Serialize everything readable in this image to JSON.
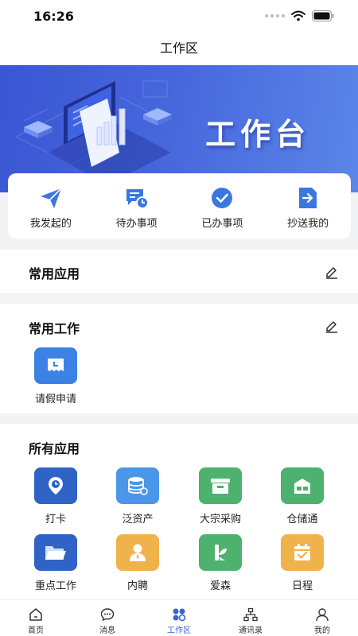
{
  "status_bar": {
    "time": "16:26"
  },
  "header": {
    "title": "工作区"
  },
  "banner": {
    "title": "工作台"
  },
  "quick_actions": [
    {
      "label": "我发起的",
      "icon": "paper-plane-icon"
    },
    {
      "label": "待办事项",
      "icon": "pending-clock-icon"
    },
    {
      "label": "已办事项",
      "icon": "check-circle-icon"
    },
    {
      "label": "抄送我的",
      "icon": "forward-doc-icon"
    }
  ],
  "common_apps": {
    "title": "常用应用"
  },
  "common_work": {
    "title": "常用工作",
    "items": [
      {
        "label": "请假申请",
        "icon": "leave-request-icon"
      }
    ]
  },
  "all_apps": {
    "title": "所有应用",
    "items": [
      {
        "label": "打卡",
        "icon": "clock-in-icon"
      },
      {
        "label": "泛资产",
        "icon": "assets-icon"
      },
      {
        "label": "大宗采购",
        "icon": "procurement-icon"
      },
      {
        "label": "仓储通",
        "icon": "warehouse-icon"
      },
      {
        "label": "重点工作",
        "icon": "folder-icon"
      },
      {
        "label": "内聘",
        "icon": "internal-hire-icon"
      },
      {
        "label": "爱森",
        "icon": "aisen-icon"
      },
      {
        "label": "日程",
        "icon": "calendar-icon"
      }
    ]
  },
  "tab_bar": {
    "active": "工作区",
    "items": [
      {
        "label": "首页",
        "icon": "home-icon"
      },
      {
        "label": "消息",
        "icon": "message-icon"
      },
      {
        "label": "工作区",
        "icon": "workspace-icon"
      },
      {
        "label": "通讯录",
        "icon": "contacts-icon"
      },
      {
        "label": "我的",
        "icon": "profile-icon"
      }
    ]
  },
  "colors": {
    "accent": "#3a63d8",
    "icon_blue": "#2f6fd6",
    "icon_light_blue": "#4a96e8",
    "icon_green": "#4cb26e",
    "icon_orange": "#f0b24a",
    "banner_start": "#3b56d4",
    "banner_end": "#5b86e8"
  }
}
